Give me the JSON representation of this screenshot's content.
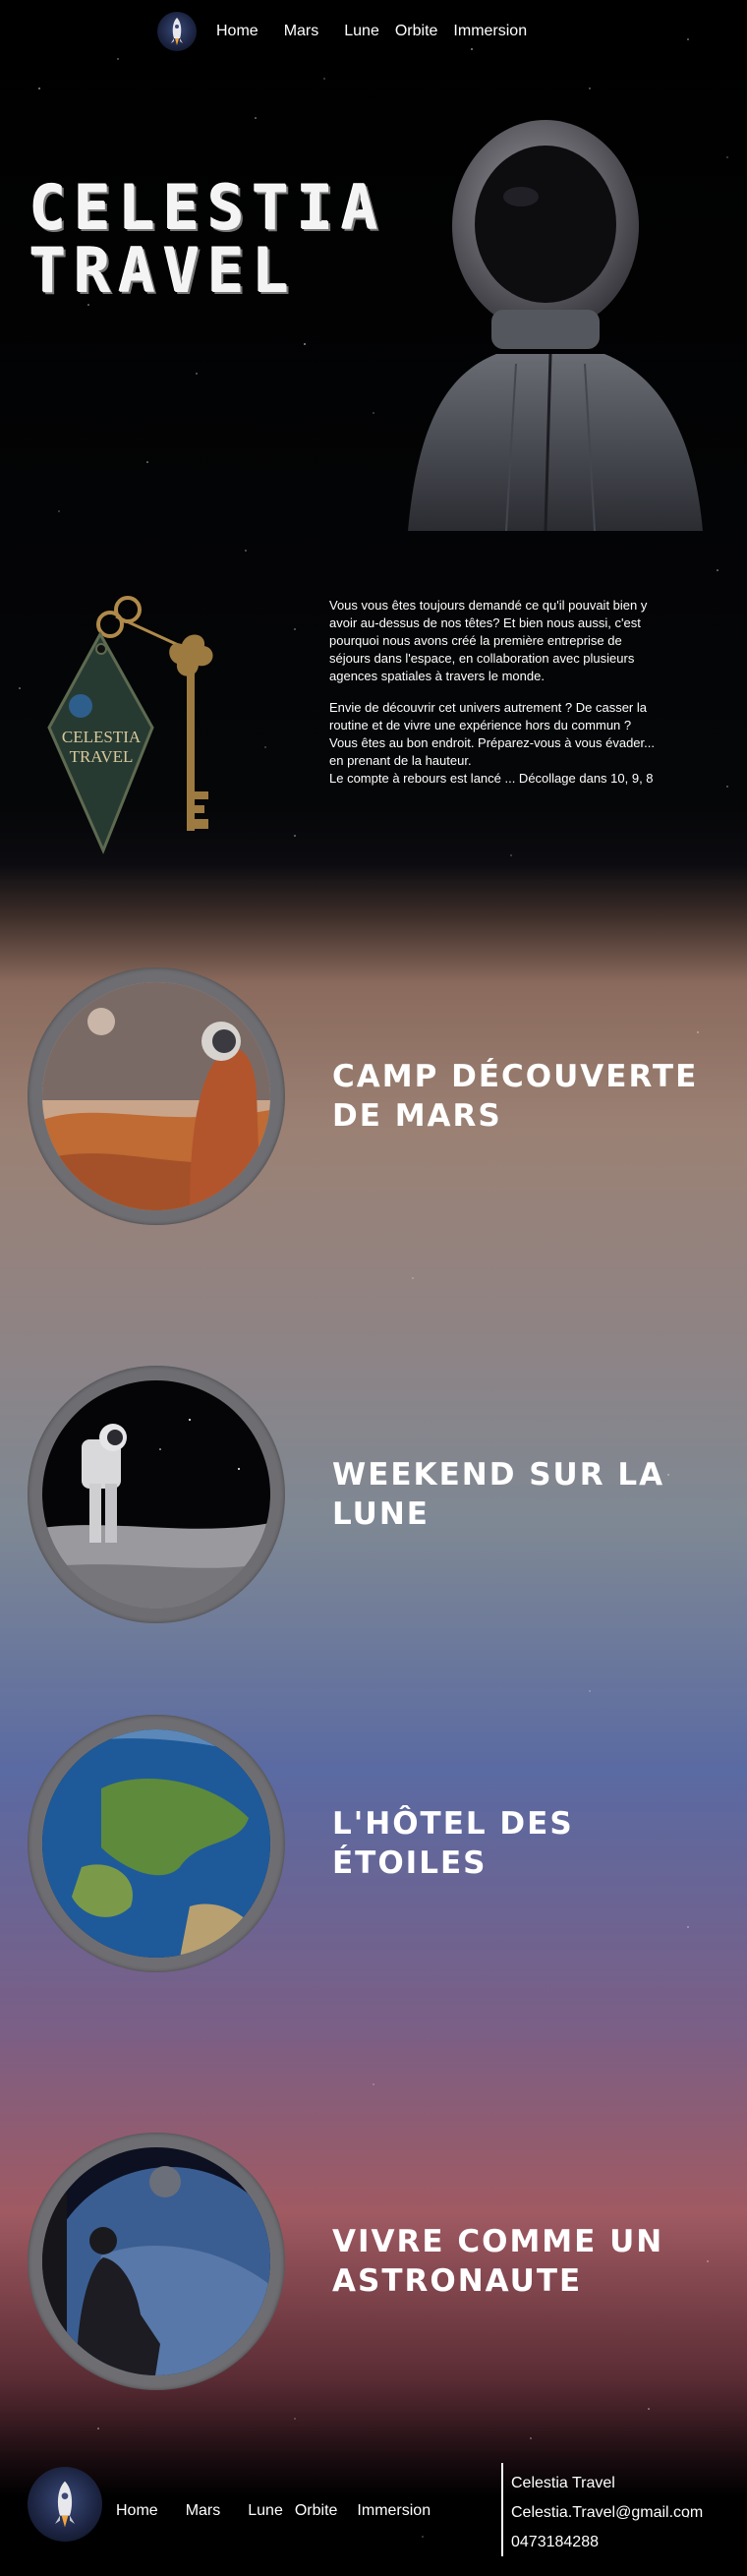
{
  "nav": {
    "logo_icon": "rocket-icon",
    "links": [
      "Home",
      "Mars",
      "Lune",
      "Orbite",
      "Immersion"
    ]
  },
  "hero": {
    "title_line1": "CELESTIA",
    "title_line2": "TRAVEL"
  },
  "keychain": {
    "tag_line1": "CELESTIA",
    "tag_line2": "TRAVEL"
  },
  "intro": {
    "p1": [
      "Vous vous êtes toujours demandé ce qu'il pouvait bien y",
      "avoir au-dessus de nos têtes? Et bien nous aussi, c'est",
      "pourquoi nous avons créé la première entreprise de",
      "séjours dans l'espace, en collaboration avec plusieurs",
      "agences spatiales à travers le monde."
    ],
    "p2": [
      "Envie de découvrir cet univers autrement ? De casser la",
      "routine et de vivre une expérience hors du commun ?",
      "Vous êtes au bon endroit. Préparez-vous à vous évader...",
      "en prenant de la hauteur.",
      "Le compte à rebours est lancé ... Décollage dans 10, 9, 8"
    ]
  },
  "offers": [
    {
      "title": "CAMP DÉCOUVERTE DE MARS"
    },
    {
      "title": "WEEKEND SUR LA LUNE"
    },
    {
      "title": "L'HÔTEL DES ÉTOILES"
    },
    {
      "title": "VIVRE COMME UN ASTRONAUTE"
    }
  ],
  "footer": {
    "links": [
      "Home",
      "Mars",
      "Lune",
      "Orbite",
      "Immersion"
    ],
    "company": "Celestia Travel",
    "email": "Celestia.Travel@gmail.com",
    "phone": "0473184288"
  }
}
